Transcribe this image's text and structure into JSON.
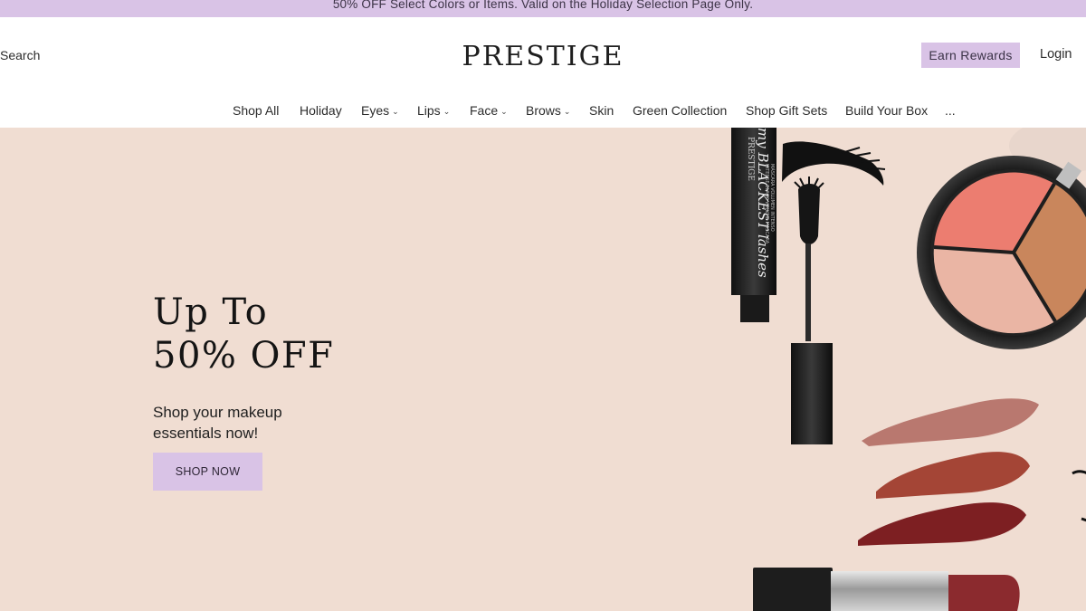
{
  "promo": {
    "text": "50% OFF Select Colors or Items. Valid on the Holiday Selection Page Only."
  },
  "header": {
    "search_label": "Search",
    "logo": "PRESTIGE",
    "rewards_label": "Earn Rewards",
    "login_label": "Login"
  },
  "nav": {
    "items": [
      {
        "label": "Shop All",
        "has_dropdown": false
      },
      {
        "label": "Holiday",
        "has_dropdown": false
      },
      {
        "label": "Eyes",
        "has_dropdown": true
      },
      {
        "label": "Lips",
        "has_dropdown": true
      },
      {
        "label": "Face",
        "has_dropdown": true
      },
      {
        "label": "Brows",
        "has_dropdown": true
      },
      {
        "label": "Skin",
        "has_dropdown": false
      },
      {
        "label": "Green Collection",
        "has_dropdown": false
      },
      {
        "label": "Shop Gift Sets",
        "has_dropdown": false
      },
      {
        "label": "Build Your Box",
        "has_dropdown": false
      },
      {
        "label": "...",
        "has_dropdown": false
      }
    ]
  },
  "hero": {
    "headline_line1": "Up To",
    "headline_line2": "50% OFF",
    "subheading": "Shop your makeup essentials now!",
    "cta_label": "SHOP NOW",
    "mascara_brand": "PRESTIGE",
    "mascara_name": "my BLACKEST lashes",
    "mascara_desc": "INTENSE BLACK VOLUME MASCARA",
    "mascara_desc2": "MÁSCARA VOLUMEN INTENSO",
    "bg_color": "#f0ddd2",
    "accent_color": "#d9c3e6"
  }
}
